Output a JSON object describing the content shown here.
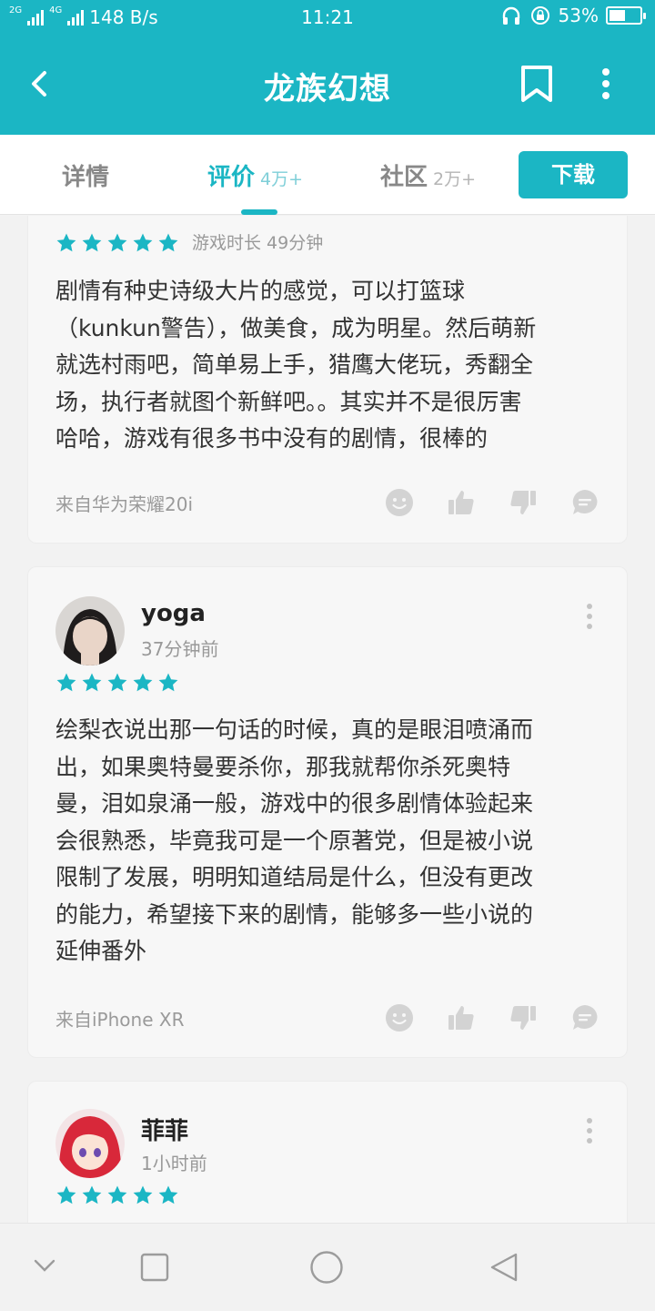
{
  "status_bar": {
    "net_left": "2G",
    "net_right": "4G",
    "speed": "148 B/s",
    "time": "11:21",
    "battery": "53%",
    "battery_level": 0.53
  },
  "header": {
    "title": "龙族幻想"
  },
  "tabs": [
    {
      "label": "详情",
      "count": ""
    },
    {
      "label": "评价",
      "count": "4万+"
    },
    {
      "label": "社区",
      "count": "2万+"
    }
  ],
  "download_label": "下载",
  "reviews": [
    {
      "user": "",
      "time": "",
      "rating": 5,
      "playtime": "游戏时长 49分钟",
      "text_lines": [
        "剧情有种史诗级大片的感觉，可以打篮球",
        "（kunkun警告），做美食，成为明星。然后萌新",
        "就选村雨吧，简单易上手，猎鹰大佬玩，秀翻全",
        "场，执行者就图个新鲜吧。。其实并不是很厉害",
        "哈哈，游戏有很多书中没有的剧情，很棒的"
      ],
      "device": "来自华为荣耀20i"
    },
    {
      "user": "yoga",
      "time": "37分钟前",
      "rating": 5,
      "text_lines": [
        "绘梨衣说出那一句话的时候，真的是眼泪喷涌而",
        "出，如果奥特曼要杀你，那我就帮你杀死奥特",
        "曼，泪如泉涌一般，游戏中的很多剧情体验起来",
        "会很熟悉，毕竟我可是一个原著党，但是被小说",
        "限制了发展，明明知道结局是什么，但没有更改",
        "的能力，希望接下来的剧情，能够多一些小说的",
        "延伸番外"
      ],
      "device": "来自iPhone XR"
    },
    {
      "user": "菲菲",
      "time": "1小时前",
      "rating": 5
    }
  ],
  "colors": {
    "accent": "#1bb6c4",
    "star": "#1bb6c4",
    "card_bg": "#f7f7f7",
    "icon_grey": "#d3d3d3"
  }
}
